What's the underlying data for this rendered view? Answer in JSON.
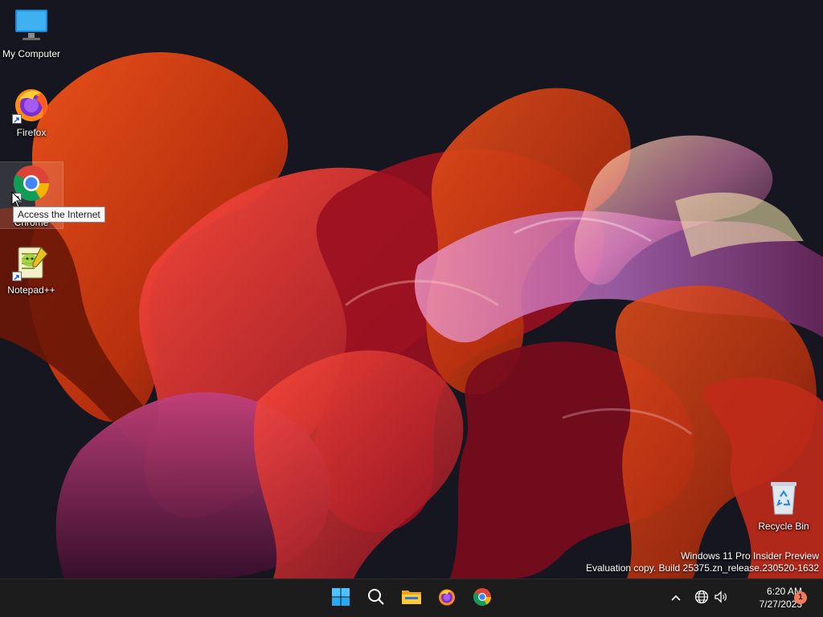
{
  "desktop": {
    "icons": [
      {
        "label": "My Computer",
        "icon": "monitor-icon"
      },
      {
        "label": "Firefox",
        "icon": "firefox-icon"
      },
      {
        "label": "Chrome",
        "icon": "chrome-icon"
      },
      {
        "label": "Notepad++",
        "icon": "notepadpp-icon"
      },
      {
        "label": "Recycle Bin",
        "icon": "recycle-bin-icon"
      }
    ],
    "tooltip": "Access the Internet",
    "watermark": {
      "line1": "Windows 11 Pro Insider Preview",
      "line2": "Evaluation copy. Build 25375.zn_release.230520-1632"
    }
  },
  "taskbar": {
    "apps": [
      "start-icon",
      "search-icon",
      "file-explorer-icon",
      "firefox-icon",
      "chrome-icon"
    ],
    "tray": {
      "icons": [
        "chevron-up-icon",
        "globe-icon",
        "speaker-icon"
      ],
      "time": "6:20 AM",
      "date": "7/27/2023",
      "notification_count": "1"
    }
  },
  "colors": {
    "taskbar_bg": "#1c1c1c",
    "accent": "#0a84ff",
    "badge": "#f07a5c"
  }
}
